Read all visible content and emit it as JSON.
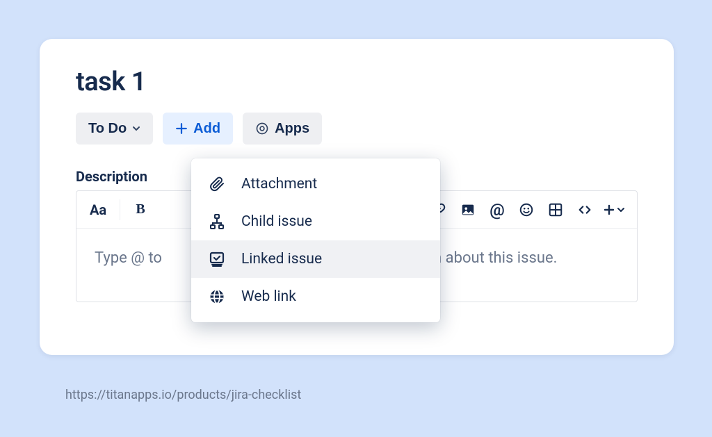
{
  "issue": {
    "title": "task 1"
  },
  "actions": {
    "status_label": "To Do",
    "add_label": "Add",
    "apps_label": "Apps"
  },
  "description": {
    "section_label": "Description",
    "placeholder_left": "Type @ to",
    "placeholder_right": "m about this issue."
  },
  "toolbar": {
    "text_styles_label": "Aa",
    "bold_label": "B"
  },
  "add_menu": {
    "items": [
      {
        "label": "Attachment"
      },
      {
        "label": "Child issue"
      },
      {
        "label": "Linked issue"
      },
      {
        "label": "Web link"
      }
    ]
  },
  "footer": {
    "url": "https://titanapps.io/products/jira-checklist"
  }
}
